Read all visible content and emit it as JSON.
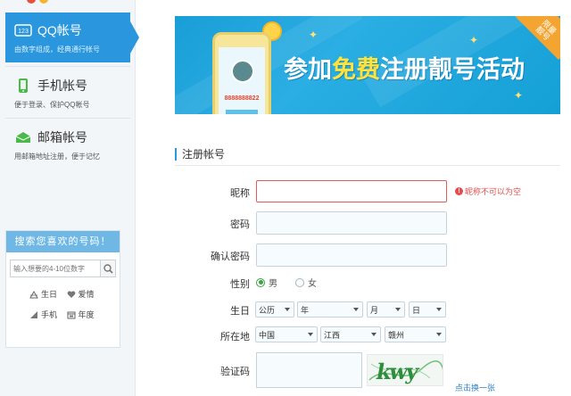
{
  "sidebar": {
    "items": [
      {
        "title": "QQ帐号",
        "subtitle": "由数字组成，经典通行帐号",
        "icon": "qq-number-icon",
        "active": true
      },
      {
        "title": "手机帐号",
        "subtitle": "便于登录、保护QQ帐号",
        "icon": "mobile-phone-icon",
        "active": false
      },
      {
        "title": "邮箱帐号",
        "subtitle": "用邮箱地址注册，便于记忆",
        "icon": "email-icon",
        "active": false
      }
    ],
    "search": {
      "title": "搜索您喜欢的号码！",
      "placeholder": "输入想要的4-10位数字",
      "quick_links": [
        {
          "label": "生日",
          "icon": "birthday-cake-icon"
        },
        {
          "label": "爱情",
          "icon": "heart-icon"
        },
        {
          "label": "手机",
          "icon": "signal-icon"
        },
        {
          "label": "年度",
          "icon": "calendar-icon"
        }
      ]
    }
  },
  "banner": {
    "headline_prefix": "参加",
    "headline_free": "免费",
    "headline_suffix": "注册靓号活动",
    "phone_number": "8888888822",
    "corner_text": "限量靓号"
  },
  "form": {
    "title": "注册帐号",
    "nickname_label": "昵称",
    "nickname_value": "",
    "nickname_error": "昵称不可以为空",
    "password_label": "密码",
    "confirm_password_label": "确认密码",
    "gender_label": "性别",
    "gender_options": [
      "男",
      "女"
    ],
    "gender_selected": "男",
    "birthday_label": "生日",
    "birthday": {
      "calendar": "公历",
      "year": "年",
      "month": "月",
      "day": "日"
    },
    "location_label": "所在地",
    "location": {
      "country": "中国",
      "province": "江西",
      "city": "赣州"
    },
    "captcha_label": "验证码",
    "captcha_text": "kwy",
    "captcha_refresh": "点击换一张"
  },
  "colors": {
    "accent": "#2996dd",
    "error": "#e24d4d",
    "radio_on": "#3aa444"
  }
}
